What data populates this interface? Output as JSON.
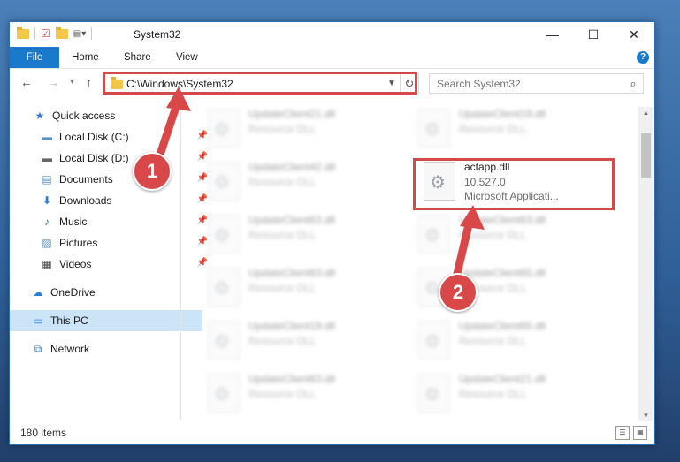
{
  "window": {
    "title": "System32",
    "controls": {
      "minimize": "—",
      "maximize": "☐",
      "close": "✕"
    }
  },
  "ribbon": {
    "tabs": [
      {
        "label": "File"
      },
      {
        "label": "Home"
      },
      {
        "label": "Share"
      },
      {
        "label": "View"
      }
    ],
    "help": "?"
  },
  "navigation": {
    "back": "←",
    "forward": "→",
    "up": "↑",
    "address": "C:\\Windows\\System32",
    "search_placeholder": "Search System32"
  },
  "sidebar": {
    "items": [
      {
        "label": "Quick access",
        "icon": "star-icon",
        "pinned": false
      },
      {
        "label": "Local Disk (C:)",
        "icon": "drive-icon",
        "pinned": true
      },
      {
        "label": "Local Disk (D:)",
        "icon": "drive-icon",
        "pinned": true
      },
      {
        "label": "Documents",
        "icon": "document-icon",
        "pinned": true
      },
      {
        "label": "Downloads",
        "icon": "download-icon",
        "pinned": true
      },
      {
        "label": "Music",
        "icon": "music-icon",
        "pinned": true
      },
      {
        "label": "Pictures",
        "icon": "pictures-icon",
        "pinned": true
      },
      {
        "label": "Videos",
        "icon": "video-icon",
        "pinned": true
      },
      {
        "label": "OneDrive",
        "icon": "cloud-icon",
        "pinned": false
      },
      {
        "label": "This PC",
        "icon": "computer-icon",
        "pinned": false,
        "selected": true
      },
      {
        "label": "Network",
        "icon": "network-icon",
        "pinned": false
      }
    ]
  },
  "files": {
    "left": [
      {
        "name": "UpdateClient21.dll",
        "sub": "Resource DLL"
      },
      {
        "name": "UpdateClient42.dll",
        "sub": "Resource DLL"
      },
      {
        "name": "UpdateClient63.dll",
        "sub": "Resource DLL"
      },
      {
        "name": "UpdateClient63.dll",
        "sub": "Resource DLL"
      },
      {
        "name": "UpdateClient19.dll",
        "sub": "Resource DLL"
      },
      {
        "name": "UpdateClient63.dll",
        "sub": "Resource DLL"
      }
    ],
    "right_top": {
      "name": "UpdateClient19.dll",
      "sub": "Resource DLL"
    },
    "highlighted": {
      "name": "actapp.dll",
      "version": "10.527.0",
      "description": "Microsoft Applicati..."
    },
    "right": [
      {
        "name": "UpdateClient63.dll",
        "sub": "Resource DLL"
      },
      {
        "name": "UpdateClient65.dll",
        "sub": "Resource DLL"
      },
      {
        "name": "UpdateClient65.dll",
        "sub": "Resource DLL"
      },
      {
        "name": "UpdateClient21.dll",
        "sub": "Resource DLL"
      }
    ]
  },
  "status": {
    "count": "180 items"
  },
  "annotations": {
    "step1": "1",
    "step2": "2"
  },
  "colors": {
    "accent": "#1979ca",
    "highlight": "#d44a4a",
    "selected": "#cce4f7"
  }
}
